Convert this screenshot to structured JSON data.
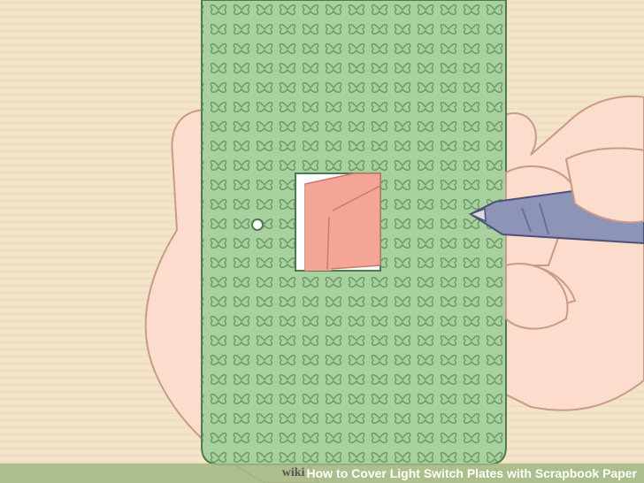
{
  "watermark": {
    "brand_prefix": "wiki",
    "brand_suffix": "How",
    "title": "to Cover Light Switch Plates with Scrapbook Paper"
  },
  "colors": {
    "background": "#f3e4c9",
    "skin": "#fbdccd",
    "skin_outline": "#c99a88",
    "paper_green": "#a9d1a0",
    "butterfly": "#5f8f5c",
    "window_pink": "#f4a596",
    "pen": "#8e93b8"
  }
}
